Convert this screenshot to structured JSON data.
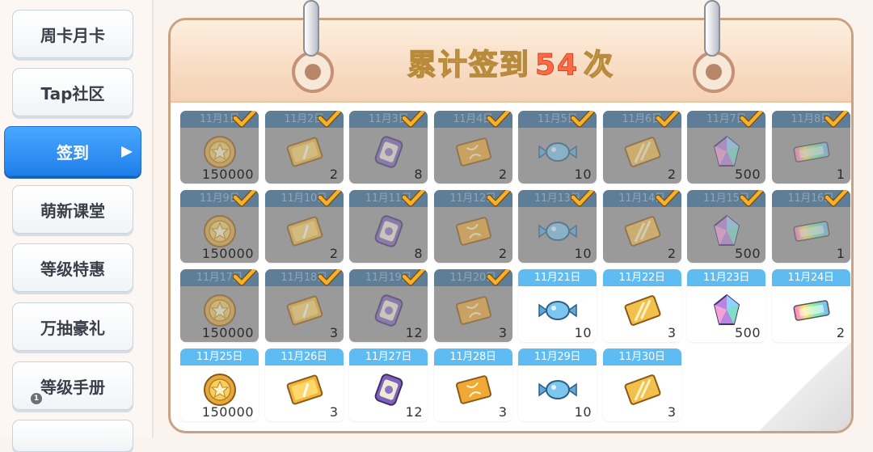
{
  "sidebar": {
    "items": [
      {
        "label": "周卡月卡",
        "active": false
      },
      {
        "label": "Tap社区",
        "active": false
      },
      {
        "label": "签到",
        "active": true
      },
      {
        "label": "萌新课堂",
        "active": false
      },
      {
        "label": "等级特惠",
        "active": false
      },
      {
        "label": "万抽豪礼",
        "active": false
      },
      {
        "label": "等级手册",
        "active": false,
        "badge": "1"
      }
    ]
  },
  "calendar": {
    "title_prefix": "累计签到",
    "count": "54",
    "title_suffix": "次",
    "days": [
      {
        "date": "11月1日",
        "item": "coin-icon",
        "qty": "150000",
        "claimed": true
      },
      {
        "date": "11月2日",
        "item": "ticket-card-icon",
        "qty": "2",
        "claimed": true
      },
      {
        "date": "11月3日",
        "item": "scroll-can-icon",
        "qty": "8",
        "claimed": true
      },
      {
        "date": "11月4日",
        "item": "dna-card-icon",
        "qty": "2",
        "claimed": true
      },
      {
        "date": "11月5日",
        "item": "candy-icon",
        "qty": "10",
        "claimed": true
      },
      {
        "date": "11月6日",
        "item": "gold-card-icon",
        "qty": "2",
        "claimed": true
      },
      {
        "date": "11月7日",
        "item": "crystal-icon",
        "qty": "500",
        "claimed": true
      },
      {
        "date": "11月8日",
        "item": "rainbow-ticket-icon",
        "qty": "1",
        "claimed": true
      },
      {
        "date": "11月9日",
        "item": "coin-icon",
        "qty": "150000",
        "claimed": true
      },
      {
        "date": "11月10日",
        "item": "ticket-card-icon",
        "qty": "2",
        "claimed": true
      },
      {
        "date": "11月11日",
        "item": "scroll-can-icon",
        "qty": "8",
        "claimed": true
      },
      {
        "date": "11月12日",
        "item": "dna-card-icon",
        "qty": "2",
        "claimed": true
      },
      {
        "date": "11月13日",
        "item": "candy-icon",
        "qty": "10",
        "claimed": true
      },
      {
        "date": "11月14日",
        "item": "gold-card-icon",
        "qty": "2",
        "claimed": true
      },
      {
        "date": "11月15日",
        "item": "crystal-icon",
        "qty": "500",
        "claimed": true
      },
      {
        "date": "11月16日",
        "item": "rainbow-ticket-icon",
        "qty": "1",
        "claimed": true
      },
      {
        "date": "11月17日",
        "item": "coin-icon",
        "qty": "150000",
        "claimed": true
      },
      {
        "date": "11月18日",
        "item": "ticket-card-icon",
        "qty": "3",
        "claimed": true
      },
      {
        "date": "11月19日",
        "item": "scroll-can-icon",
        "qty": "12",
        "claimed": true
      },
      {
        "date": "11月20日",
        "item": "dna-card-icon",
        "qty": "3",
        "claimed": true
      },
      {
        "date": "11月21日",
        "item": "candy-icon",
        "qty": "10",
        "claimed": false
      },
      {
        "date": "11月22日",
        "item": "gold-card-icon",
        "qty": "3",
        "claimed": false
      },
      {
        "date": "11月23日",
        "item": "crystal-icon",
        "qty": "500",
        "claimed": false
      },
      {
        "date": "11月24日",
        "item": "rainbow-ticket-icon",
        "qty": "2",
        "claimed": false
      },
      {
        "date": "11月25日",
        "item": "coin-icon",
        "qty": "150000",
        "claimed": false
      },
      {
        "date": "11月26日",
        "item": "ticket-card-icon",
        "qty": "3",
        "claimed": false
      },
      {
        "date": "11月27日",
        "item": "scroll-can-icon",
        "qty": "12",
        "claimed": false
      },
      {
        "date": "11月28日",
        "item": "dna-card-icon",
        "qty": "3",
        "claimed": false
      },
      {
        "date": "11月29日",
        "item": "candy-icon",
        "qty": "10",
        "claimed": false
      },
      {
        "date": "11月30日",
        "item": "gold-card-icon",
        "qty": "3",
        "claimed": false
      }
    ]
  },
  "colors": {
    "accent": "#1f7fea",
    "date_bar": "#5fbcf2",
    "claimed_overlay": "#9a9a9a",
    "check": "#f5b12a",
    "count": "#ff6a45"
  }
}
